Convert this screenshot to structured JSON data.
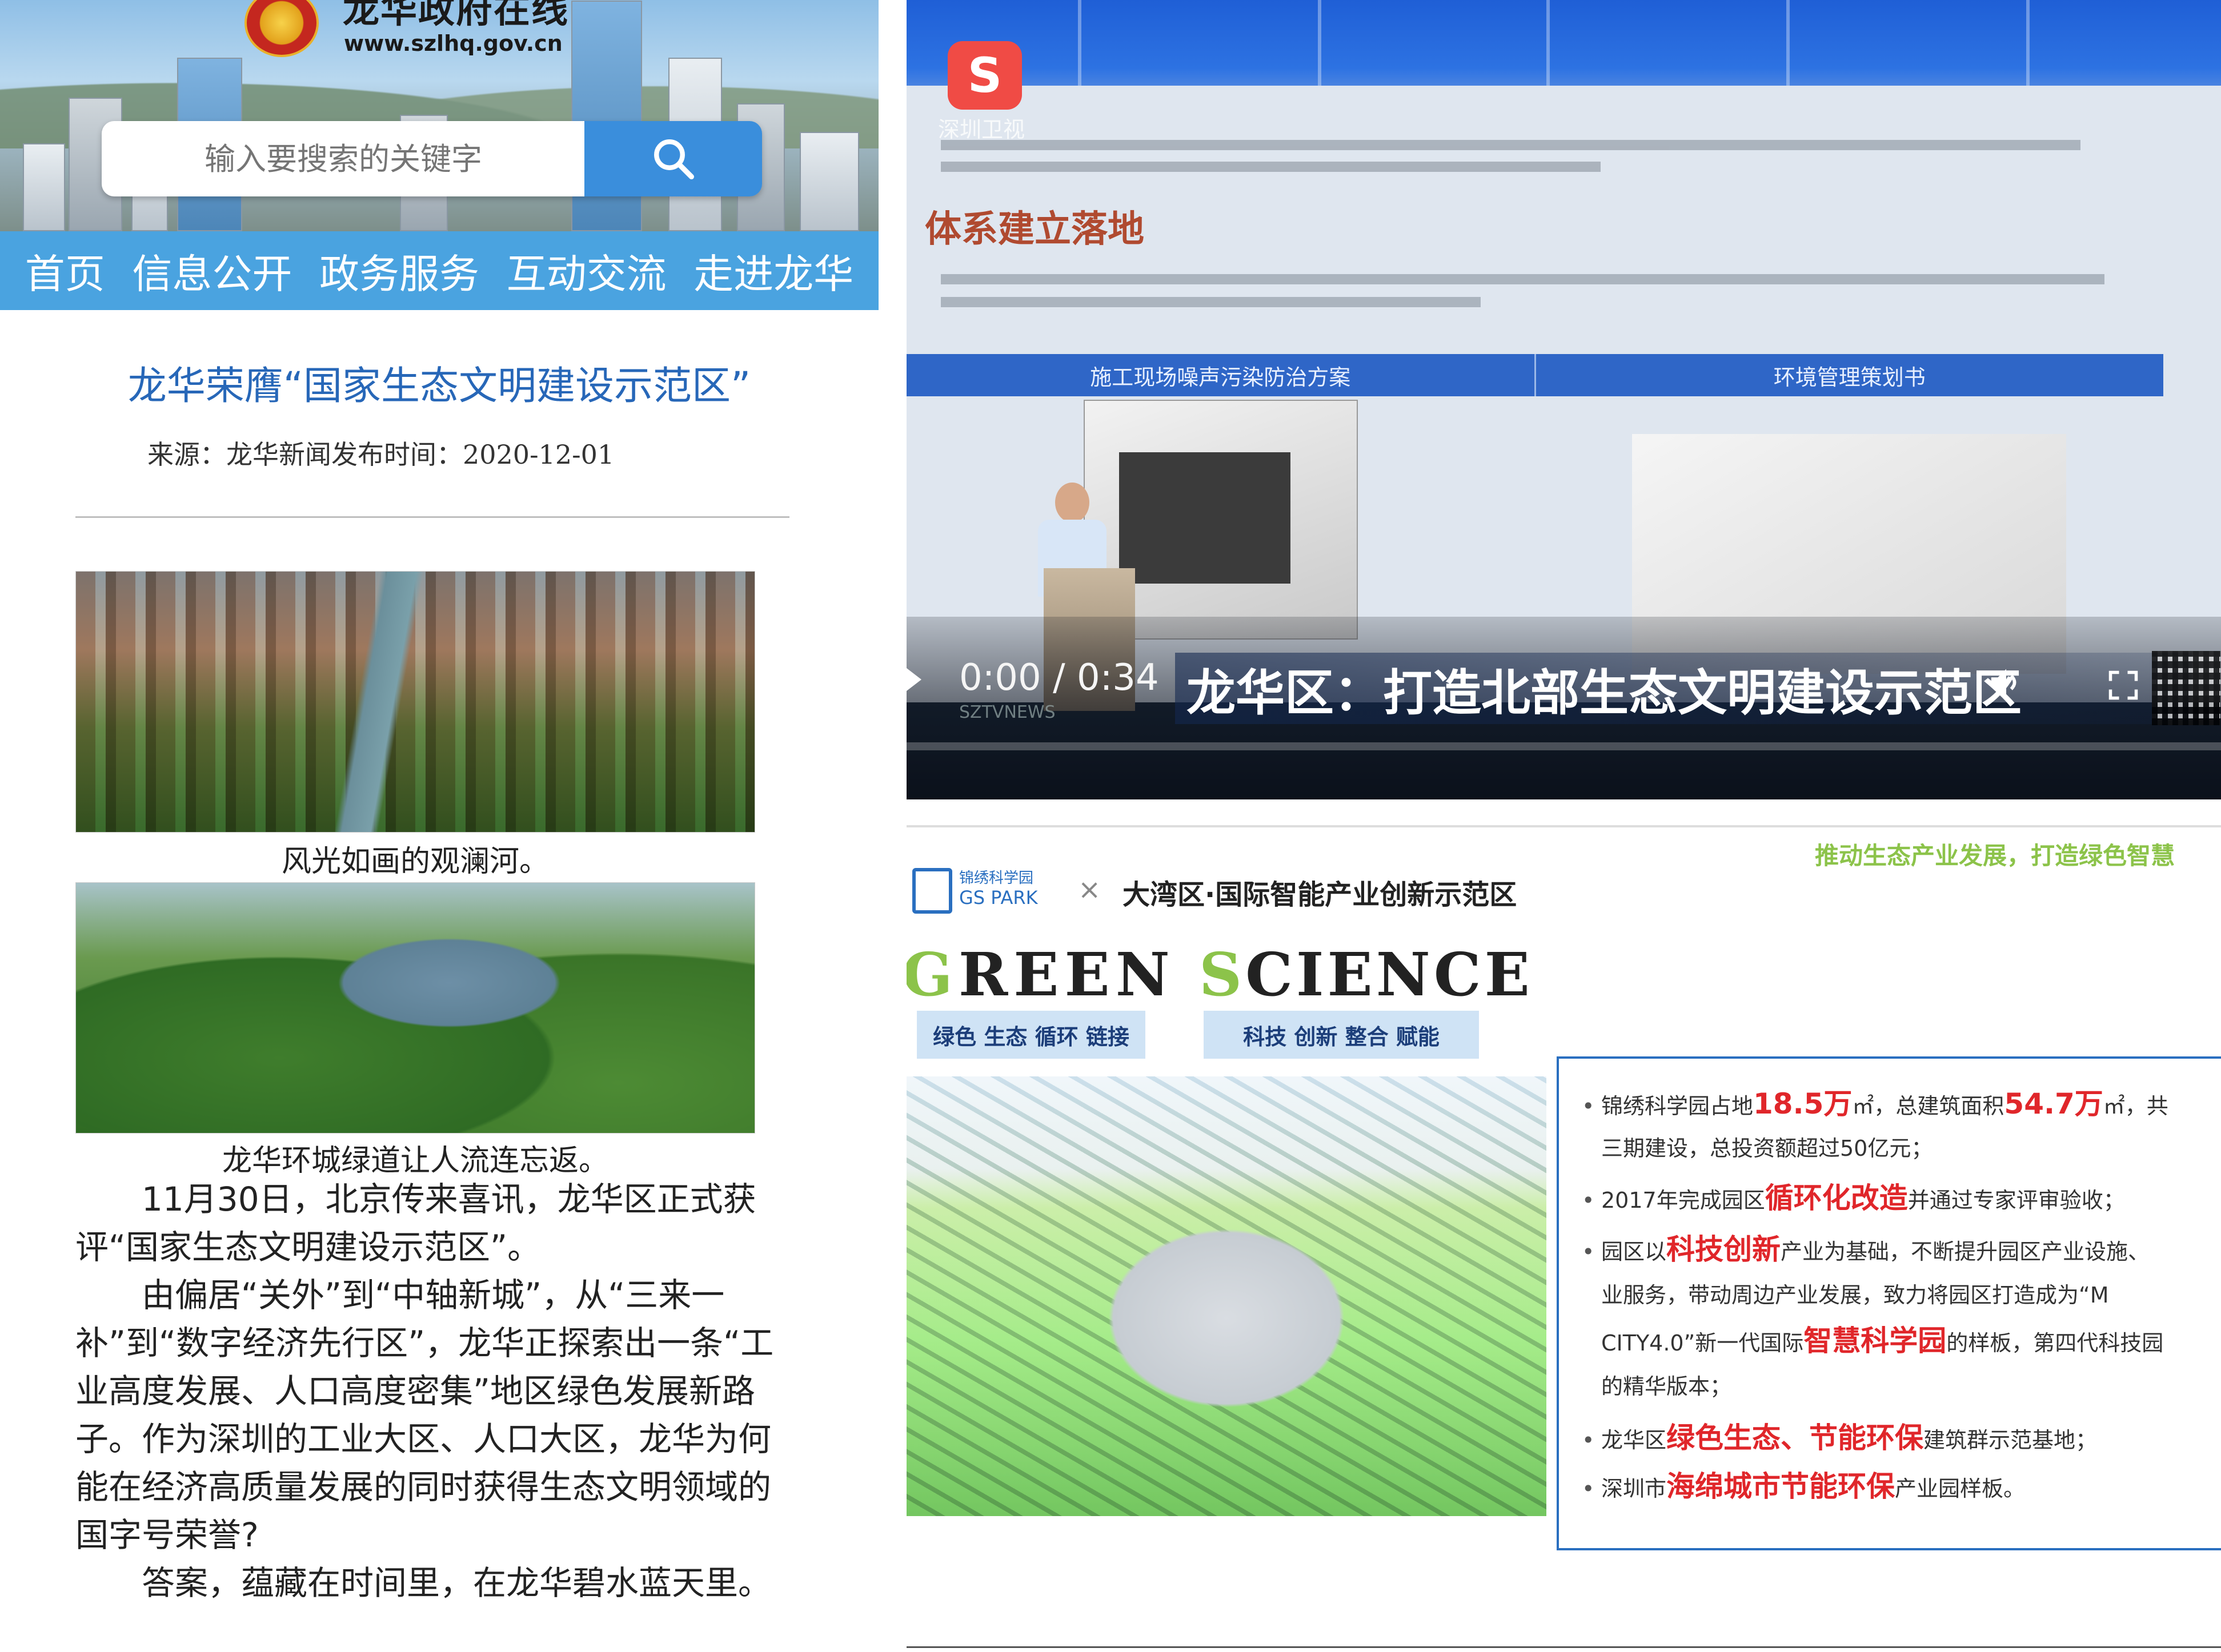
{
  "gov_site": {
    "site_name": "龙华政府在线",
    "site_url": "www.szlhq.gov.cn",
    "search": {
      "placeholder": "输入要搜索的关键字"
    },
    "nav": [
      "首页",
      "信息公开",
      "政务服务",
      "互动交流",
      "走进龙华"
    ],
    "article": {
      "title": "龙华荣膺“国家生态文明建设示范区”",
      "meta": "来源：龙华新闻发布时间：2020-12-01",
      "captions": [
        "风光如画的观澜河。",
        "龙华环城绿道让人流连忘返。"
      ],
      "paragraphs": [
        "11月30日，北京传来喜讯，龙华区正式获评“国家生态文明建设示范区”。",
        "由偏居“关外”到“中轴新城”，从“三来一补”到“数字经济先行区”，龙华正探索出一条“工业高度发展、人口高度密集”地区绿色发展新路子。作为深圳的工业大区、人口大区，龙华为何能在经济高质量发展的同时获得生态文明领域的国字号荣誉?",
        "答案，蕴藏在时间里，在龙华碧水蓝天里。"
      ]
    }
  },
  "video": {
    "channel_label": "深圳卫视",
    "slide_heading": "体系建立落地",
    "slide_columns": [
      "施工现场噪声污染防治方案",
      "环境管理策划书"
    ],
    "time": "0:00 / 0:34",
    "ticker": "SZTVNEWS",
    "caption": "龙华区：打造北部生态文明建设示范区",
    "progress": 0.0
  },
  "gs_slide": {
    "tagline": "推动生态产业发展，打造绿色智慧",
    "logo_cn": "锦绣科学园",
    "logo_en": "GS PARK",
    "times": "×",
    "bay_area_title": "大湾区·国际智能产业创新示范区",
    "green_first": "G",
    "green_rest": "REEN",
    "science_first": "S",
    "science_rest": "CIENCE",
    "green_tag": "绿色 生态 循环 链接",
    "science_tag": "科技 创新 整合 赋能",
    "bullets": [
      {
        "pre": "锦绣科学园占地",
        "hl": "18.5万",
        "mid": "㎡，总建筑面积",
        "hl2": "54.7万",
        "post": "㎡，共"
      },
      {
        "pre": "三期建设，总投资额超过50亿元；"
      },
      {
        "pre": "2017年完成园区",
        "hl": "循环化改造",
        "post": "并通过专家评审验收；"
      },
      {
        "pre": "园区以",
        "hl": "科技创新",
        "post": "产业为基础，不断提升园区产业设施、"
      },
      {
        "pre": "业服务，带动周边产业发展，致力将园区打造成为“M"
      },
      {
        "pre": "CITY4.0”新一代国际",
        "hl": "智慧科学园",
        "post": "的样板，第四代科技园"
      },
      {
        "pre": "的精华版本；"
      },
      {
        "pre": "龙华区",
        "hl": "绿色生态、节能环保",
        "post": "建筑群示范基地；"
      },
      {
        "pre": "深圳市",
        "hl": "海绵城市节能环保",
        "post": "产业园样板。"
      }
    ]
  }
}
